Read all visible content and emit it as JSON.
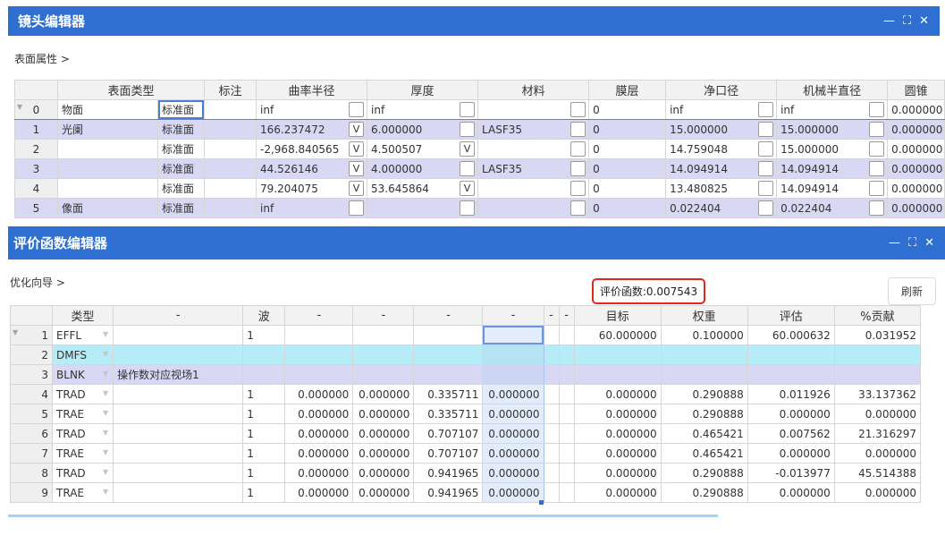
{
  "lens_editor": {
    "title": "镜头编辑器",
    "breadcrumb": "表面属性 >",
    "controls": {
      "minimize": "—",
      "maximize": "⛶",
      "close": "✕"
    },
    "headers": [
      "",
      "表面类型",
      "",
      "标注",
      "曲率半径",
      "",
      "厚度",
      "",
      "材料",
      "",
      "膜层",
      "净口径",
      "",
      "机械半直径",
      "",
      "圆锥"
    ],
    "rows": [
      {
        "idx": "0",
        "name": "物面",
        "type": "标准面",
        "note": "",
        "radius": "inf",
        "radius_flag": "",
        "thickness": "inf",
        "thick_flag": "",
        "material": "",
        "mat_flag": "",
        "coating": "0",
        "clear_ap": "inf",
        "ca_flag": "",
        "mech": "inf",
        "mech_flag": "",
        "conic": "0.000000"
      },
      {
        "idx": "1",
        "name": "光阑",
        "type": "标准面",
        "note": "",
        "radius": "166.237472",
        "radius_flag": "V",
        "thickness": "6.000000",
        "thick_flag": "",
        "material": "LASF35",
        "mat_flag": "",
        "coating": "0",
        "clear_ap": "15.000000",
        "ca_flag": "",
        "mech": "15.000000",
        "mech_flag": "",
        "conic": "0.000000"
      },
      {
        "idx": "2",
        "name": "",
        "type": "标准面",
        "note": "",
        "radius": "-2,968.840565",
        "radius_flag": "V",
        "thickness": "4.500507",
        "thick_flag": "V",
        "material": "",
        "mat_flag": "",
        "coating": "0",
        "clear_ap": "14.759048",
        "ca_flag": "",
        "mech": "15.000000",
        "mech_flag": "",
        "conic": "0.000000"
      },
      {
        "idx": "3",
        "name": "",
        "type": "标准面",
        "note": "",
        "radius": "44.526146",
        "radius_flag": "V",
        "thickness": "4.000000",
        "thick_flag": "",
        "material": "LASF35",
        "mat_flag": "",
        "coating": "0",
        "clear_ap": "14.094914",
        "ca_flag": "",
        "mech": "14.094914",
        "mech_flag": "",
        "conic": "0.000000"
      },
      {
        "idx": "4",
        "name": "",
        "type": "标准面",
        "note": "",
        "radius": "79.204075",
        "radius_flag": "V",
        "thickness": "53.645864",
        "thick_flag": "V",
        "material": "",
        "mat_flag": "",
        "coating": "0",
        "clear_ap": "13.480825",
        "ca_flag": "",
        "mech": "14.094914",
        "mech_flag": "",
        "conic": "0.000000"
      },
      {
        "idx": "5",
        "name": "像面",
        "type": "标准面",
        "note": "",
        "radius": "inf",
        "radius_flag": "",
        "thickness": "",
        "thick_flag": "",
        "material": "",
        "mat_flag": "",
        "coating": "0",
        "clear_ap": "0.022404",
        "ca_flag": "",
        "mech": "0.022404",
        "mech_flag": "",
        "conic": "0.000000"
      }
    ]
  },
  "merit_editor": {
    "title": "评价函数编辑器",
    "breadcrumb": "优化向导 >",
    "controls": {
      "minimize": "—",
      "maximize": "⛶",
      "close": "✕"
    },
    "merit_value": "评价函数:0.007543",
    "refresh_label": "刷新",
    "headers": [
      "",
      "类型",
      "-",
      "波",
      "-",
      "-",
      "-",
      "-",
      "-",
      "-",
      "目标",
      "权重",
      "评估",
      "%贡献"
    ],
    "rows": [
      {
        "idx": "1",
        "type": "EFFL",
        "c1": "",
        "wave": "1",
        "c3": "",
        "c4": "",
        "c5": "",
        "c6": "",
        "c7": "",
        "c8": "",
        "target": "60.000000",
        "weight": "0.100000",
        "value": "60.000632",
        "contrib": "0.031952"
      },
      {
        "idx": "2",
        "type": "DMFS",
        "c1": "",
        "wave": "",
        "c3": "",
        "c4": "",
        "c5": "",
        "c6": "",
        "c7": "",
        "c8": "",
        "target": "",
        "weight": "",
        "value": "",
        "contrib": ""
      },
      {
        "idx": "3",
        "type": "BLNK",
        "c1": "操作数对应视场1",
        "wave": "",
        "c3": "",
        "c4": "",
        "c5": "",
        "c6": "",
        "c7": "",
        "c8": "",
        "target": "",
        "weight": "",
        "value": "",
        "contrib": ""
      },
      {
        "idx": "4",
        "type": "TRAD",
        "c1": "",
        "wave": "1",
        "c3": "0.000000",
        "c4": "0.000000",
        "c5": "0.335711",
        "c6": "0.000000",
        "c7": "",
        "c8": "",
        "target": "0.000000",
        "weight": "0.290888",
        "value": "0.011926",
        "contrib": "33.137362"
      },
      {
        "idx": "5",
        "type": "TRAE",
        "c1": "",
        "wave": "1",
        "c3": "0.000000",
        "c4": "0.000000",
        "c5": "0.335711",
        "c6": "0.000000",
        "c7": "",
        "c8": "",
        "target": "0.000000",
        "weight": "0.290888",
        "value": "0.000000",
        "contrib": "0.000000"
      },
      {
        "idx": "6",
        "type": "TRAD",
        "c1": "",
        "wave": "1",
        "c3": "0.000000",
        "c4": "0.000000",
        "c5": "0.707107",
        "c6": "0.000000",
        "c7": "",
        "c8": "",
        "target": "0.000000",
        "weight": "0.465421",
        "value": "0.007562",
        "contrib": "21.316297"
      },
      {
        "idx": "7",
        "type": "TRAE",
        "c1": "",
        "wave": "1",
        "c3": "0.000000",
        "c4": "0.000000",
        "c5": "0.707107",
        "c6": "0.000000",
        "c7": "",
        "c8": "",
        "target": "0.000000",
        "weight": "0.465421",
        "value": "0.000000",
        "contrib": "0.000000"
      },
      {
        "idx": "8",
        "type": "TRAD",
        "c1": "",
        "wave": "1",
        "c3": "0.000000",
        "c4": "0.000000",
        "c5": "0.941965",
        "c6": "0.000000",
        "c7": "",
        "c8": "",
        "target": "0.000000",
        "weight": "0.290888",
        "value": "-0.013977",
        "contrib": "45.514388"
      },
      {
        "idx": "9",
        "type": "TRAE",
        "c1": "",
        "wave": "1",
        "c3": "0.000000",
        "c4": "0.000000",
        "c5": "0.941965",
        "c6": "0.000000",
        "c7": "",
        "c8": "",
        "target": "0.000000",
        "weight": "0.290888",
        "value": "0.000000",
        "contrib": "0.000000"
      }
    ]
  }
}
